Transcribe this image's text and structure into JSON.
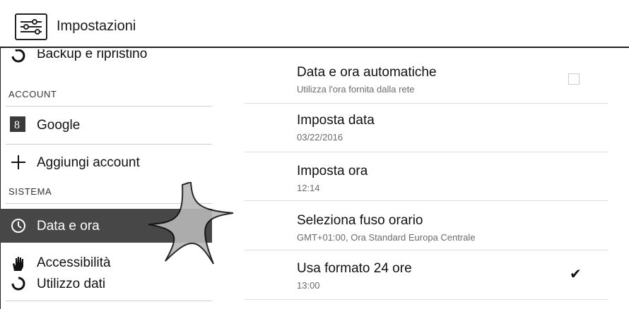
{
  "header": {
    "title": "Impostazioni",
    "icon": "settings-sliders-icon"
  },
  "sidebar": {
    "partial_item": {
      "label": "Backup e ripristino",
      "icon": "backup-icon"
    },
    "sections": [
      {
        "header": "ACCOUNT"
      },
      {
        "header": "SISTEMA"
      }
    ],
    "items": [
      {
        "label": "Google",
        "icon": "google-icon"
      },
      {
        "label": "Aggiungi account",
        "icon": "plus-icon"
      },
      {
        "label": "Data e ora",
        "icon": "clock-icon",
        "selected": true
      },
      {
        "label": "Accessibilità",
        "icon": "hand-icon"
      },
      {
        "label": "Utilizzo dati",
        "icon": "data-usage-icon"
      }
    ]
  },
  "settings": [
    {
      "title": "Data e ora automatiche",
      "summary": "Utilizza l'ora fornita dalla rete",
      "control": "checkbox",
      "checked": false
    },
    {
      "title": "Imposta data",
      "summary": "03/22/2016"
    },
    {
      "title": "Imposta ora",
      "summary": "12:14"
    },
    {
      "title": "Seleziona fuso orario",
      "summary": "GMT+01:00, Ora Standard Europa Centrale"
    },
    {
      "title": "Usa formato 24 ore",
      "summary": "13:00",
      "control": "checkmark",
      "checked": true
    }
  ],
  "colors": {
    "selected_bg": "#474747",
    "divider": "#dcdcdc",
    "summary_text": "#6b6b6b"
  }
}
